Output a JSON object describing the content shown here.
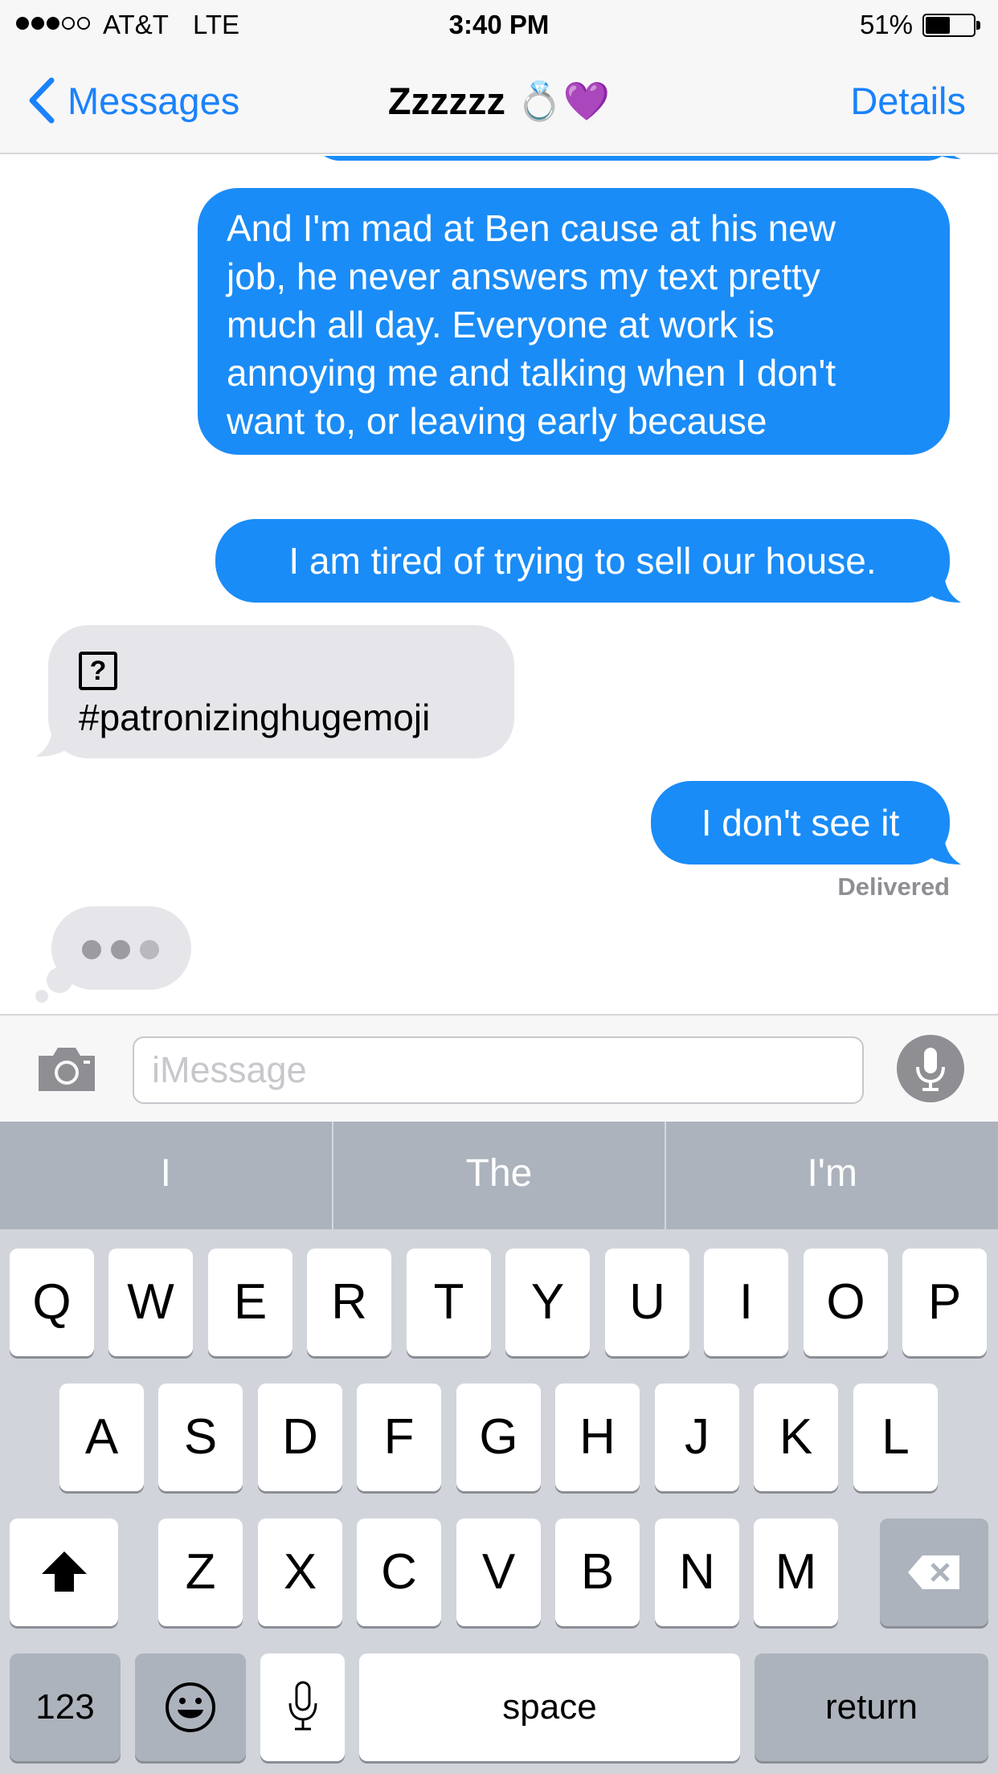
{
  "status_bar": {
    "carrier": "AT&T",
    "network": "LTE",
    "time": "3:40 PM",
    "battery_percent": "51%",
    "battery_level": 0.51,
    "signal_bars": 3,
    "signal_total": 5
  },
  "nav": {
    "back_label": "Messages",
    "title": "Zzzzzz",
    "title_emoji": "💍💜",
    "details_label": "Details"
  },
  "messages": [
    {
      "direction": "outgoing",
      "text": ""
    },
    {
      "direction": "outgoing",
      "text": "And I'm mad at Ben cause at his new\njob, he never answers my text pretty\nmuch all day. Everyone at work is\nannoying me and talking when I don't\nwant to, or leaving early because\n\"big surprise\" they are sick, again."
    },
    {
      "direction": "outgoing",
      "text": "I am tired of trying to sell our house."
    },
    {
      "direction": "incoming",
      "icon": "missing-glyph-icon",
      "icon_text": "?",
      "text": "#patronizinghugemoji"
    },
    {
      "direction": "outgoing",
      "text": "I don't see it"
    }
  ],
  "delivered_label": "Delivered",
  "input": {
    "placeholder": "iMessage"
  },
  "keyboard": {
    "predictions": [
      "I",
      "The",
      "I'm"
    ],
    "row1": [
      "Q",
      "W",
      "E",
      "R",
      "T",
      "Y",
      "U",
      "I",
      "O",
      "P"
    ],
    "row2": [
      "A",
      "S",
      "D",
      "F",
      "G",
      "H",
      "J",
      "K",
      "L"
    ],
    "row3": [
      "Z",
      "X",
      "C",
      "V",
      "B",
      "N",
      "M"
    ],
    "numbers_label": "123",
    "space_label": "space",
    "return_label": "return"
  },
  "colors": {
    "outgoing_bubble": "#1a8cf7",
    "incoming_bubble": "#e6e6ea",
    "accent": "#1a82fb"
  }
}
